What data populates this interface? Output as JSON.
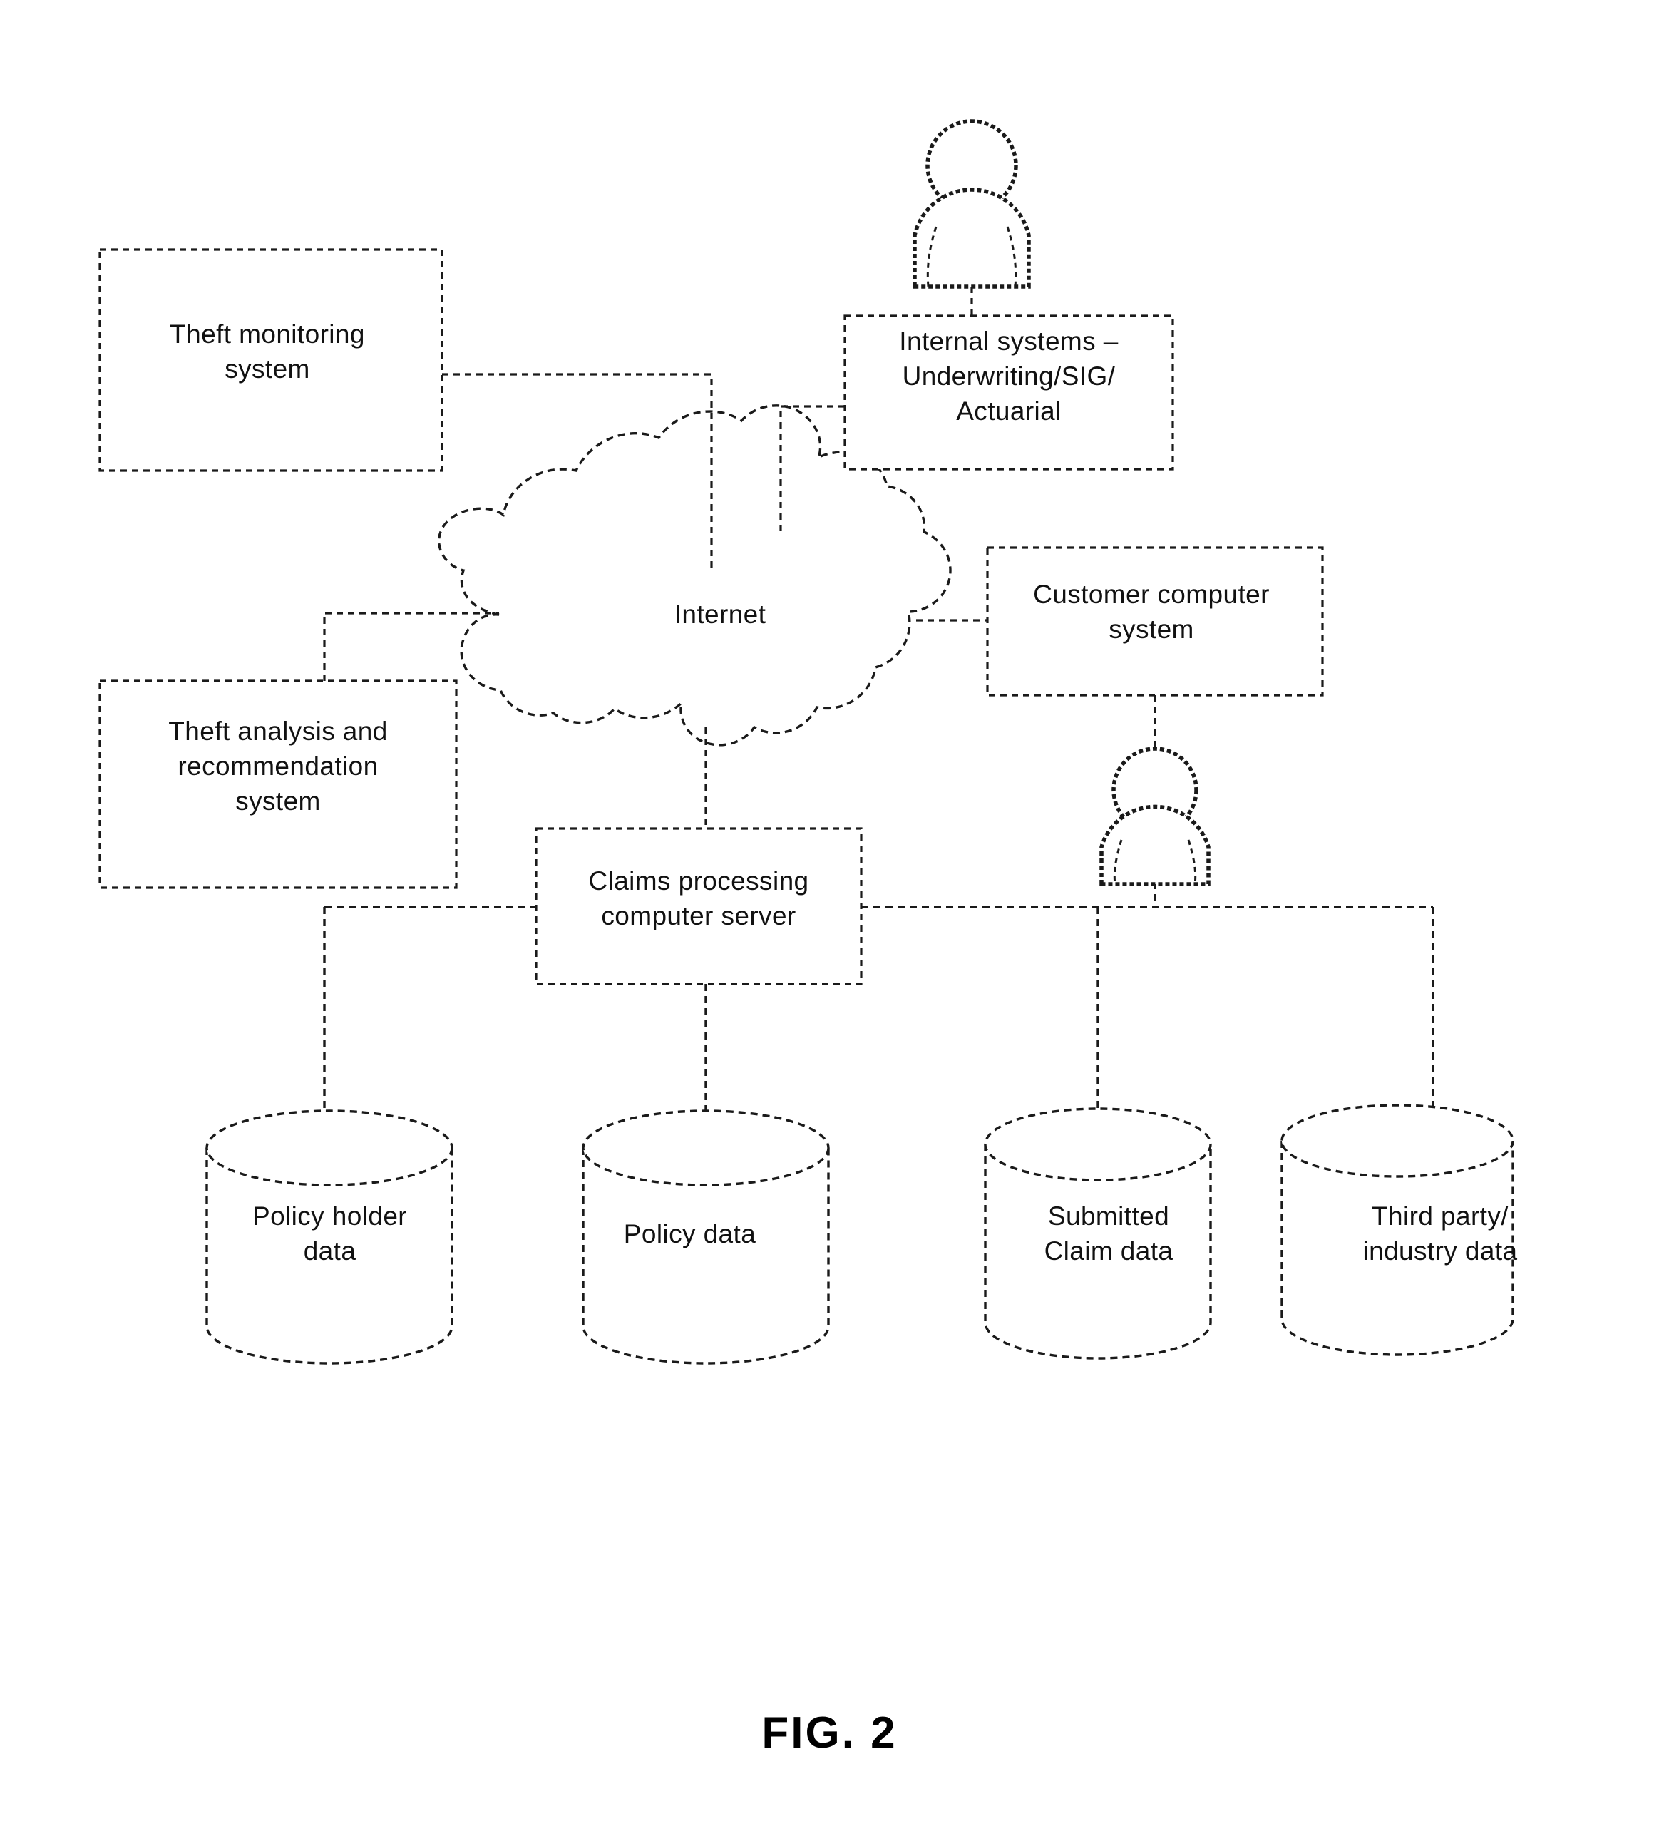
{
  "figure": {
    "caption": "FIG. 2",
    "title": "Insurance claims processing system architecture"
  },
  "nodes": {
    "theft_monitoring": {
      "label": "Theft monitoring\nsystem",
      "shape": "rectangle"
    },
    "internal_systems": {
      "label": "Internal systems –\nUnderwriting/SIG/\nActuarial",
      "shape": "rectangle"
    },
    "internet": {
      "label": "Internet",
      "shape": "cloud"
    },
    "customer_system": {
      "label": "Customer computer\nsystem",
      "shape": "rectangle"
    },
    "theft_analysis": {
      "label": "Theft analysis and\nrecommendation\nsystem",
      "shape": "rectangle"
    },
    "claims_server": {
      "label": "Claims processing\ncomputer server",
      "shape": "rectangle"
    },
    "policy_holder_data": {
      "label": "Policy holder\ndata",
      "shape": "cylinder"
    },
    "policy_data": {
      "label": "Policy data",
      "shape": "cylinder"
    },
    "submitted_claim_data": {
      "label": "Submitted\nClaim data",
      "shape": "cylinder"
    },
    "third_party_data": {
      "label": "Third party/\nindustry data",
      "shape": "cylinder"
    }
  },
  "actors": {
    "top_user": {
      "name": "user-person-icon"
    },
    "customer_user": {
      "name": "customer-person-icon"
    }
  },
  "style": {
    "stroke": "#1a1a1a",
    "background": "#ffffff",
    "line_style": "dashed"
  }
}
